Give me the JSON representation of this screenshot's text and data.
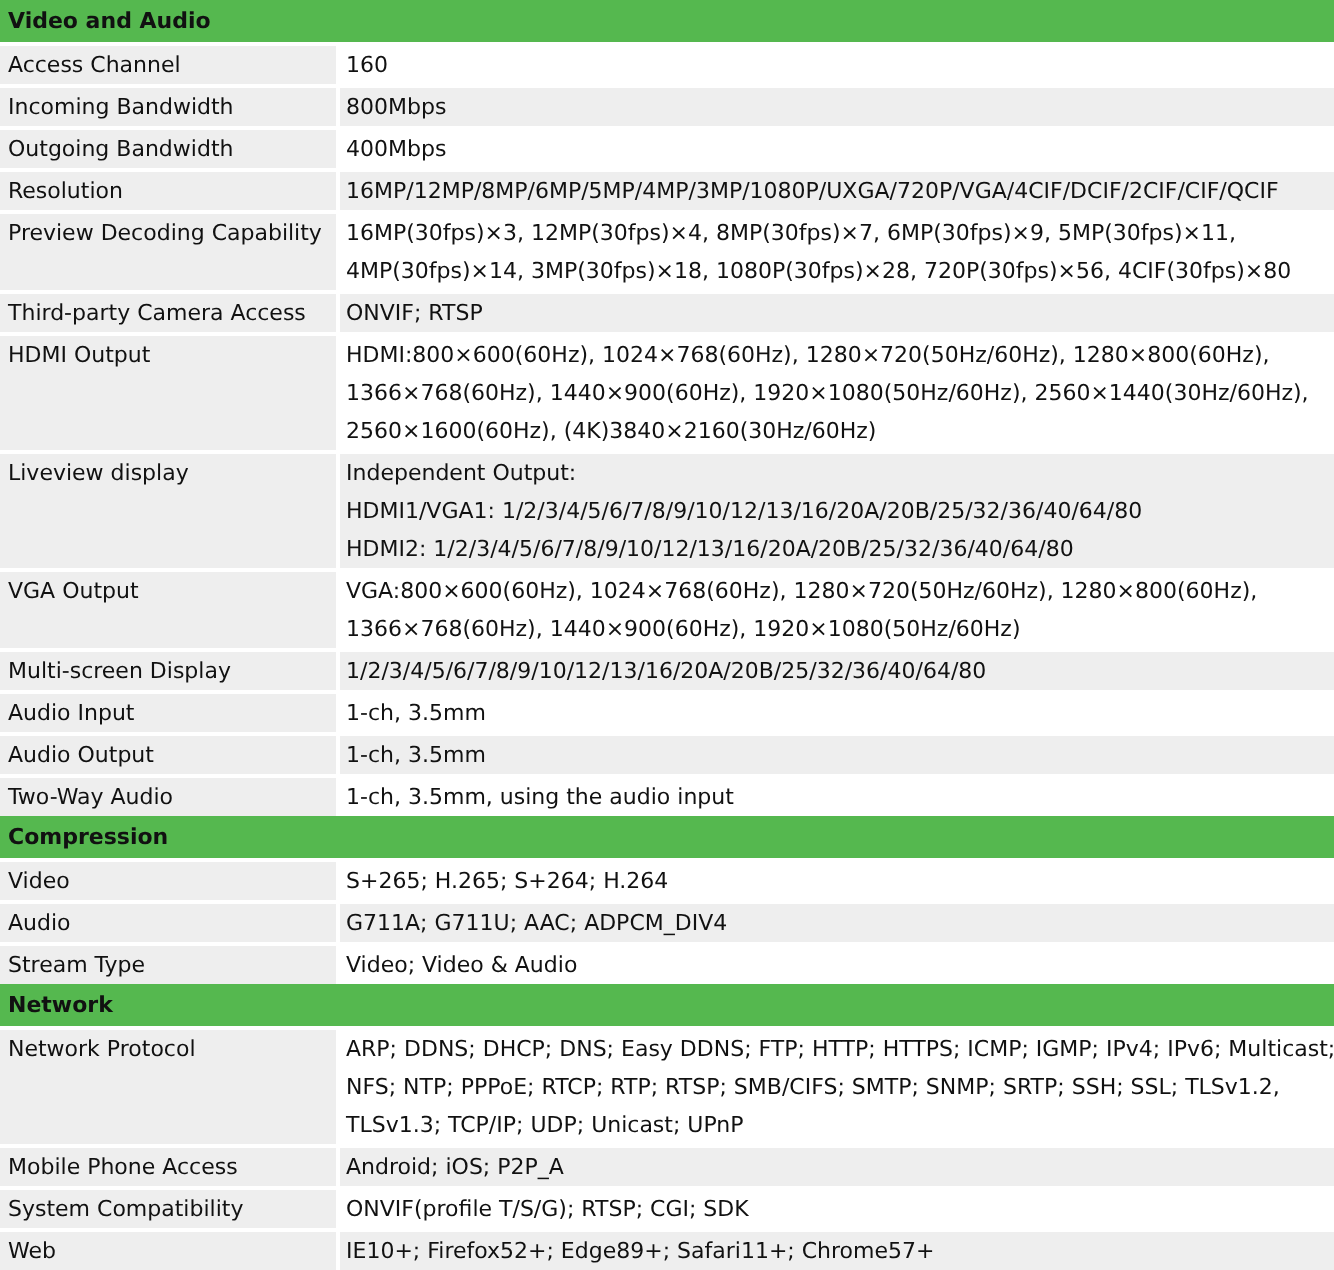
{
  "sections": [
    {
      "title": "Video and Audio",
      "rows": [
        {
          "label": "Access Channel",
          "value_lines": [
            "160"
          ]
        },
        {
          "label": "Incoming Bandwidth",
          "value_lines": [
            "800Mbps"
          ]
        },
        {
          "label": "Outgoing Bandwidth",
          "value_lines": [
            "400Mbps"
          ]
        },
        {
          "label": "Resolution",
          "value_lines": [
            "16MP/12MP/8MP/6MP/5MP/4MP/3MP/1080P/UXGA/720P/VGA/4CIF/DCIF/2CIF/CIF/QCIF"
          ]
        },
        {
          "label": "Preview Decoding Capability",
          "value_lines": [
            "16MP(30fps)×3, 12MP(30fps)×4, 8MP(30fps)×7, 6MP(30fps)×9, 5MP(30fps)×11,",
            "4MP(30fps)×14, 3MP(30fps)×18, 1080P(30fps)×28, 720P(30fps)×56, 4CIF(30fps)×80"
          ]
        },
        {
          "label": "Third-party Camera Access",
          "value_lines": [
            "ONVIF; RTSP"
          ]
        },
        {
          "label": "HDMI Output",
          "value_lines": [
            "HDMI:800×600(60Hz), 1024×768(60Hz), 1280×720(50Hz/60Hz), 1280×800(60Hz),",
            "1366×768(60Hz), 1440×900(60Hz), 1920×1080(50Hz/60Hz), 2560×1440(30Hz/60Hz),",
            "2560×1600(60Hz), (4K)3840×2160(30Hz/60Hz)"
          ]
        },
        {
          "label": "Liveview display",
          "value_lines": [
            "Independent Output:",
            "HDMI1/VGA1: 1/2/3/4/5/6/7/8/9/10/12/13/16/20A/20B/25/32/36/40/64/80",
            "HDMI2: 1/2/3/4/5/6/7/8/9/10/12/13/16/20A/20B/25/32/36/40/64/80"
          ]
        },
        {
          "label": "VGA Output",
          "value_lines": [
            "VGA:800×600(60Hz), 1024×768(60Hz), 1280×720(50Hz/60Hz), 1280×800(60Hz),",
            "1366×768(60Hz), 1440×900(60Hz), 1920×1080(50Hz/60Hz)"
          ]
        },
        {
          "label": "Multi-screen Display",
          "value_lines": [
            "1/2/3/4/5/6/7/8/9/10/12/13/16/20A/20B/25/32/36/40/64/80"
          ]
        },
        {
          "label": "Audio Input",
          "value_lines": [
            "1-ch, 3.5mm"
          ]
        },
        {
          "label": "Audio Output",
          "value_lines": [
            "1-ch, 3.5mm"
          ]
        },
        {
          "label": "Two-Way Audio",
          "value_lines": [
            "1-ch, 3.5mm, using the audio input"
          ]
        }
      ]
    },
    {
      "title": "Compression",
      "rows": [
        {
          "label": "Video",
          "value_lines": [
            "S+265; H.265; S+264; H.264"
          ]
        },
        {
          "label": "Audio",
          "value_lines": [
            "G711A; G711U; AAC; ADPCM_DIV4"
          ]
        },
        {
          "label": "Stream Type",
          "value_lines": [
            "Video; Video & Audio"
          ]
        }
      ]
    },
    {
      "title": "Network",
      "rows": [
        {
          "label": "Network Protocol",
          "value_lines": [
            "ARP; DDNS; DHCP; DNS; Easy DDNS; FTP; HTTP; HTTPS; ICMP; IGMP; IPv4; IPv6; Multicast;",
            "NFS; NTP; PPPoE; RTCP; RTP; RTSP; SMB/CIFS; SMTP; SNMP; SRTP; SSH; SSL; TLSv1.2,",
            "TLSv1.3; TCP/IP; UDP; Unicast; UPnP"
          ]
        },
        {
          "label": "Mobile Phone Access",
          "value_lines": [
            "Android; iOS; P2P_A"
          ]
        },
        {
          "label": "System Compatibility",
          "value_lines": [
            "ONVIF(profile T/S/G); RTSP; CGI; SDK"
          ]
        },
        {
          "label": "Web",
          "value_lines": [
            "IE10+; Firefox52+; Edge89+; Safari11+; Chrome57+"
          ]
        }
      ]
    }
  ]
}
